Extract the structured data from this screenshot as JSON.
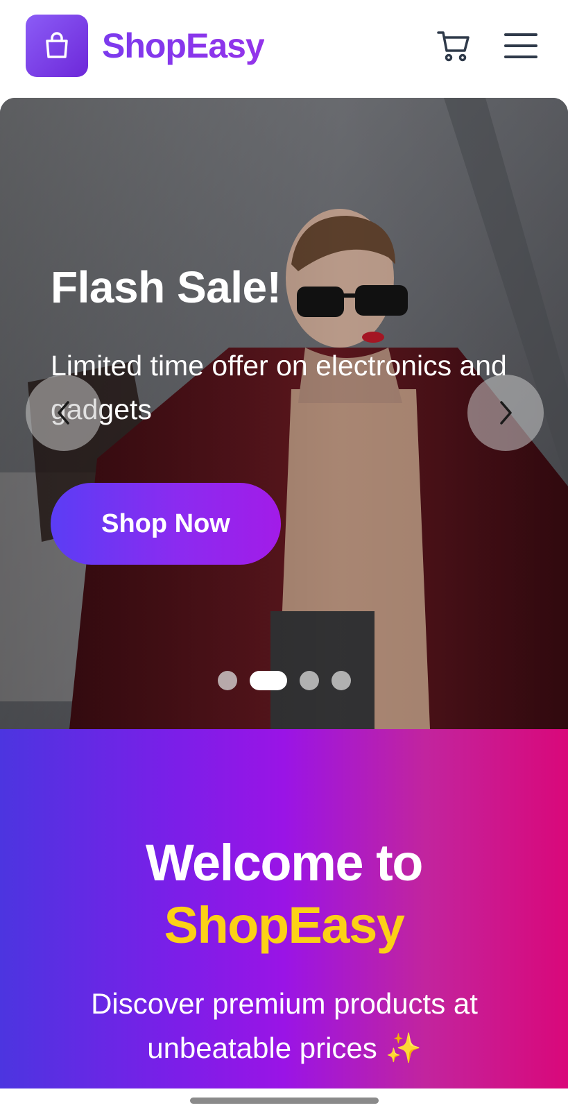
{
  "header": {
    "brand": "ShopEasy",
    "logo_icon": "shopping-bag-icon",
    "cart_icon": "cart-icon",
    "menu_icon": "hamburger-menu-icon"
  },
  "hero": {
    "title": "Flash Sale!",
    "subtitle": "Limited time offer on electronics and gadgets",
    "cta_label": "Shop Now",
    "prev_icon": "chevron-left-icon",
    "next_icon": "chevron-right-icon",
    "slide_count": 4,
    "active_slide": 2
  },
  "welcome": {
    "line1": "Welcome to",
    "line2": "ShopEasy",
    "subtitle": "Discover premium products at unbeatable prices ✨"
  },
  "colors": {
    "brand_purple": "#7c3aed",
    "accent_yellow": "#fcd116",
    "gradient_start": "#4c35e0",
    "gradient_mid": "#9a14e6",
    "gradient_end": "#d9087a"
  }
}
